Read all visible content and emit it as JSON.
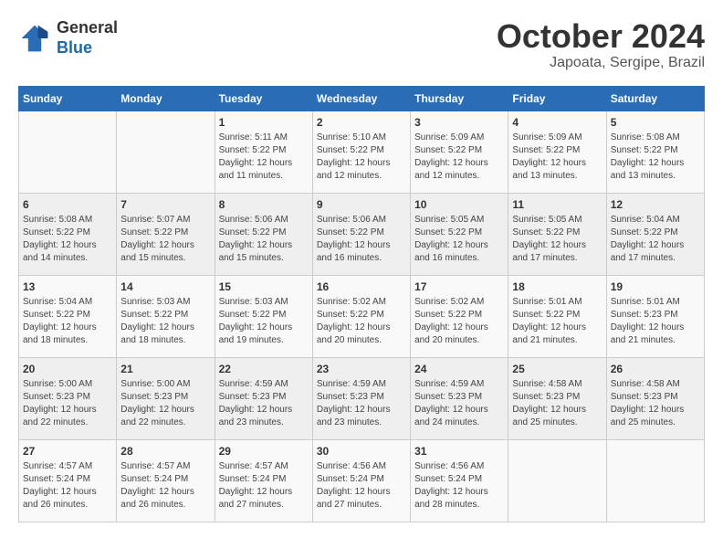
{
  "header": {
    "logo_line1": "General",
    "logo_line2": "Blue",
    "month": "October 2024",
    "location": "Japoata, Sergipe, Brazil"
  },
  "weekdays": [
    "Sunday",
    "Monday",
    "Tuesday",
    "Wednesday",
    "Thursday",
    "Friday",
    "Saturday"
  ],
  "weeks": [
    [
      {
        "day": "",
        "info": ""
      },
      {
        "day": "",
        "info": ""
      },
      {
        "day": "1",
        "info": "Sunrise: 5:11 AM\nSunset: 5:22 PM\nDaylight: 12 hours\nand 11 minutes."
      },
      {
        "day": "2",
        "info": "Sunrise: 5:10 AM\nSunset: 5:22 PM\nDaylight: 12 hours\nand 12 minutes."
      },
      {
        "day": "3",
        "info": "Sunrise: 5:09 AM\nSunset: 5:22 PM\nDaylight: 12 hours\nand 12 minutes."
      },
      {
        "day": "4",
        "info": "Sunrise: 5:09 AM\nSunset: 5:22 PM\nDaylight: 12 hours\nand 13 minutes."
      },
      {
        "day": "5",
        "info": "Sunrise: 5:08 AM\nSunset: 5:22 PM\nDaylight: 12 hours\nand 13 minutes."
      }
    ],
    [
      {
        "day": "6",
        "info": "Sunrise: 5:08 AM\nSunset: 5:22 PM\nDaylight: 12 hours\nand 14 minutes."
      },
      {
        "day": "7",
        "info": "Sunrise: 5:07 AM\nSunset: 5:22 PM\nDaylight: 12 hours\nand 15 minutes."
      },
      {
        "day": "8",
        "info": "Sunrise: 5:06 AM\nSunset: 5:22 PM\nDaylight: 12 hours\nand 15 minutes."
      },
      {
        "day": "9",
        "info": "Sunrise: 5:06 AM\nSunset: 5:22 PM\nDaylight: 12 hours\nand 16 minutes."
      },
      {
        "day": "10",
        "info": "Sunrise: 5:05 AM\nSunset: 5:22 PM\nDaylight: 12 hours\nand 16 minutes."
      },
      {
        "day": "11",
        "info": "Sunrise: 5:05 AM\nSunset: 5:22 PM\nDaylight: 12 hours\nand 17 minutes."
      },
      {
        "day": "12",
        "info": "Sunrise: 5:04 AM\nSunset: 5:22 PM\nDaylight: 12 hours\nand 17 minutes."
      }
    ],
    [
      {
        "day": "13",
        "info": "Sunrise: 5:04 AM\nSunset: 5:22 PM\nDaylight: 12 hours\nand 18 minutes."
      },
      {
        "day": "14",
        "info": "Sunrise: 5:03 AM\nSunset: 5:22 PM\nDaylight: 12 hours\nand 18 minutes."
      },
      {
        "day": "15",
        "info": "Sunrise: 5:03 AM\nSunset: 5:22 PM\nDaylight: 12 hours\nand 19 minutes."
      },
      {
        "day": "16",
        "info": "Sunrise: 5:02 AM\nSunset: 5:22 PM\nDaylight: 12 hours\nand 20 minutes."
      },
      {
        "day": "17",
        "info": "Sunrise: 5:02 AM\nSunset: 5:22 PM\nDaylight: 12 hours\nand 20 minutes."
      },
      {
        "day": "18",
        "info": "Sunrise: 5:01 AM\nSunset: 5:22 PM\nDaylight: 12 hours\nand 21 minutes."
      },
      {
        "day": "19",
        "info": "Sunrise: 5:01 AM\nSunset: 5:23 PM\nDaylight: 12 hours\nand 21 minutes."
      }
    ],
    [
      {
        "day": "20",
        "info": "Sunrise: 5:00 AM\nSunset: 5:23 PM\nDaylight: 12 hours\nand 22 minutes."
      },
      {
        "day": "21",
        "info": "Sunrise: 5:00 AM\nSunset: 5:23 PM\nDaylight: 12 hours\nand 22 minutes."
      },
      {
        "day": "22",
        "info": "Sunrise: 4:59 AM\nSunset: 5:23 PM\nDaylight: 12 hours\nand 23 minutes."
      },
      {
        "day": "23",
        "info": "Sunrise: 4:59 AM\nSunset: 5:23 PM\nDaylight: 12 hours\nand 23 minutes."
      },
      {
        "day": "24",
        "info": "Sunrise: 4:59 AM\nSunset: 5:23 PM\nDaylight: 12 hours\nand 24 minutes."
      },
      {
        "day": "25",
        "info": "Sunrise: 4:58 AM\nSunset: 5:23 PM\nDaylight: 12 hours\nand 25 minutes."
      },
      {
        "day": "26",
        "info": "Sunrise: 4:58 AM\nSunset: 5:23 PM\nDaylight: 12 hours\nand 25 minutes."
      }
    ],
    [
      {
        "day": "27",
        "info": "Sunrise: 4:57 AM\nSunset: 5:24 PM\nDaylight: 12 hours\nand 26 minutes."
      },
      {
        "day": "28",
        "info": "Sunrise: 4:57 AM\nSunset: 5:24 PM\nDaylight: 12 hours\nand 26 minutes."
      },
      {
        "day": "29",
        "info": "Sunrise: 4:57 AM\nSunset: 5:24 PM\nDaylight: 12 hours\nand 27 minutes."
      },
      {
        "day": "30",
        "info": "Sunrise: 4:56 AM\nSunset: 5:24 PM\nDaylight: 12 hours\nand 27 minutes."
      },
      {
        "day": "31",
        "info": "Sunrise: 4:56 AM\nSunset: 5:24 PM\nDaylight: 12 hours\nand 28 minutes."
      },
      {
        "day": "",
        "info": ""
      },
      {
        "day": "",
        "info": ""
      }
    ]
  ]
}
